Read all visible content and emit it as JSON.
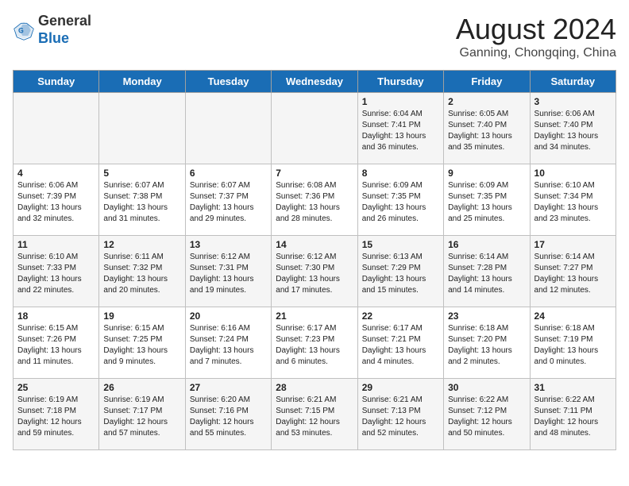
{
  "header": {
    "logo_general": "General",
    "logo_blue": "Blue",
    "month_year": "August 2024",
    "location": "Ganning, Chongqing, China"
  },
  "days_of_week": [
    "Sunday",
    "Monday",
    "Tuesday",
    "Wednesday",
    "Thursday",
    "Friday",
    "Saturday"
  ],
  "weeks": [
    [
      {
        "day": "",
        "info": ""
      },
      {
        "day": "",
        "info": ""
      },
      {
        "day": "",
        "info": ""
      },
      {
        "day": "",
        "info": ""
      },
      {
        "day": "1",
        "info": "Sunrise: 6:04 AM\nSunset: 7:41 PM\nDaylight: 13 hours\nand 36 minutes."
      },
      {
        "day": "2",
        "info": "Sunrise: 6:05 AM\nSunset: 7:40 PM\nDaylight: 13 hours\nand 35 minutes."
      },
      {
        "day": "3",
        "info": "Sunrise: 6:06 AM\nSunset: 7:40 PM\nDaylight: 13 hours\nand 34 minutes."
      }
    ],
    [
      {
        "day": "4",
        "info": "Sunrise: 6:06 AM\nSunset: 7:39 PM\nDaylight: 13 hours\nand 32 minutes."
      },
      {
        "day": "5",
        "info": "Sunrise: 6:07 AM\nSunset: 7:38 PM\nDaylight: 13 hours\nand 31 minutes."
      },
      {
        "day": "6",
        "info": "Sunrise: 6:07 AM\nSunset: 7:37 PM\nDaylight: 13 hours\nand 29 minutes."
      },
      {
        "day": "7",
        "info": "Sunrise: 6:08 AM\nSunset: 7:36 PM\nDaylight: 13 hours\nand 28 minutes."
      },
      {
        "day": "8",
        "info": "Sunrise: 6:09 AM\nSunset: 7:35 PM\nDaylight: 13 hours\nand 26 minutes."
      },
      {
        "day": "9",
        "info": "Sunrise: 6:09 AM\nSunset: 7:35 PM\nDaylight: 13 hours\nand 25 minutes."
      },
      {
        "day": "10",
        "info": "Sunrise: 6:10 AM\nSunset: 7:34 PM\nDaylight: 13 hours\nand 23 minutes."
      }
    ],
    [
      {
        "day": "11",
        "info": "Sunrise: 6:10 AM\nSunset: 7:33 PM\nDaylight: 13 hours\nand 22 minutes."
      },
      {
        "day": "12",
        "info": "Sunrise: 6:11 AM\nSunset: 7:32 PM\nDaylight: 13 hours\nand 20 minutes."
      },
      {
        "day": "13",
        "info": "Sunrise: 6:12 AM\nSunset: 7:31 PM\nDaylight: 13 hours\nand 19 minutes."
      },
      {
        "day": "14",
        "info": "Sunrise: 6:12 AM\nSunset: 7:30 PM\nDaylight: 13 hours\nand 17 minutes."
      },
      {
        "day": "15",
        "info": "Sunrise: 6:13 AM\nSunset: 7:29 PM\nDaylight: 13 hours\nand 15 minutes."
      },
      {
        "day": "16",
        "info": "Sunrise: 6:14 AM\nSunset: 7:28 PM\nDaylight: 13 hours\nand 14 minutes."
      },
      {
        "day": "17",
        "info": "Sunrise: 6:14 AM\nSunset: 7:27 PM\nDaylight: 13 hours\nand 12 minutes."
      }
    ],
    [
      {
        "day": "18",
        "info": "Sunrise: 6:15 AM\nSunset: 7:26 PM\nDaylight: 13 hours\nand 11 minutes."
      },
      {
        "day": "19",
        "info": "Sunrise: 6:15 AM\nSunset: 7:25 PM\nDaylight: 13 hours\nand 9 minutes."
      },
      {
        "day": "20",
        "info": "Sunrise: 6:16 AM\nSunset: 7:24 PM\nDaylight: 13 hours\nand 7 minutes."
      },
      {
        "day": "21",
        "info": "Sunrise: 6:17 AM\nSunset: 7:23 PM\nDaylight: 13 hours\nand 6 minutes."
      },
      {
        "day": "22",
        "info": "Sunrise: 6:17 AM\nSunset: 7:21 PM\nDaylight: 13 hours\nand 4 minutes."
      },
      {
        "day": "23",
        "info": "Sunrise: 6:18 AM\nSunset: 7:20 PM\nDaylight: 13 hours\nand 2 minutes."
      },
      {
        "day": "24",
        "info": "Sunrise: 6:18 AM\nSunset: 7:19 PM\nDaylight: 13 hours\nand 0 minutes."
      }
    ],
    [
      {
        "day": "25",
        "info": "Sunrise: 6:19 AM\nSunset: 7:18 PM\nDaylight: 12 hours\nand 59 minutes."
      },
      {
        "day": "26",
        "info": "Sunrise: 6:19 AM\nSunset: 7:17 PM\nDaylight: 12 hours\nand 57 minutes."
      },
      {
        "day": "27",
        "info": "Sunrise: 6:20 AM\nSunset: 7:16 PM\nDaylight: 12 hours\nand 55 minutes."
      },
      {
        "day": "28",
        "info": "Sunrise: 6:21 AM\nSunset: 7:15 PM\nDaylight: 12 hours\nand 53 minutes."
      },
      {
        "day": "29",
        "info": "Sunrise: 6:21 AM\nSunset: 7:13 PM\nDaylight: 12 hours\nand 52 minutes."
      },
      {
        "day": "30",
        "info": "Sunrise: 6:22 AM\nSunset: 7:12 PM\nDaylight: 12 hours\nand 50 minutes."
      },
      {
        "day": "31",
        "info": "Sunrise: 6:22 AM\nSunset: 7:11 PM\nDaylight: 12 hours\nand 48 minutes."
      }
    ]
  ]
}
